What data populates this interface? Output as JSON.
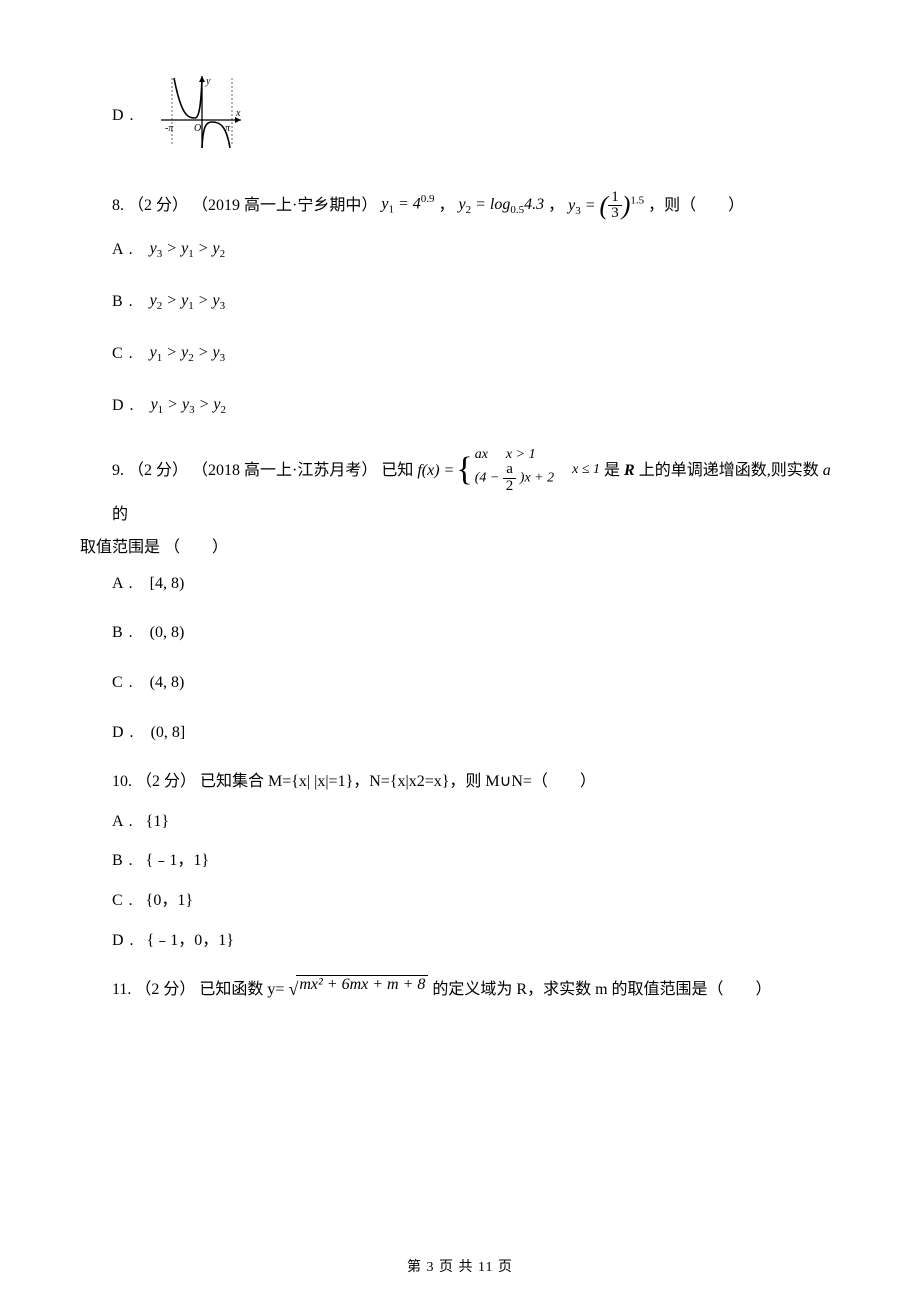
{
  "q7_optD_label": "D .",
  "q8": {
    "stem_prefix": "8.  （2 分） （2019 高一上·宁乡期中）",
    "y1_lhs": "y",
    "y1_sub": "1",
    "y1_eq": "= 4",
    "y1_exp": "0.9",
    "comma1": "，",
    "y2_lhs": "y",
    "y2_sub": "2",
    "y2_eq": "= log",
    "y2_logbase": "0.5",
    "y2_arg": "4.3",
    "comma2": "，",
    "y3_lhs": "y",
    "y3_sub": "3",
    "y3_eq": "=",
    "y3_frac_num": "1",
    "y3_frac_den": "3",
    "y3_exp": "1.5",
    "stem_suffix": "，则（　　）",
    "options": {
      "A": {
        "label": "A .",
        "expr": "y₃ > y₁ > y₂"
      },
      "B": {
        "label": "B .",
        "expr": "y₂ > y₁ > y₃"
      },
      "C": {
        "label": "C .",
        "expr": "y₁ > y₂ > y₃"
      },
      "D": {
        "label": "D .",
        "expr": "y₁ > y₃ > y₂"
      }
    }
  },
  "q9": {
    "stem_prefix": "9.  （2 分） （2018 高一上·江苏月考） 已知",
    "fx": "f",
    "fx_x": "(x) =",
    "row1_left": "ax",
    "row1_right": "x > 1",
    "row2_left_a": "(4 −",
    "row2_left_frac_num": "a",
    "row2_left_frac_den": "2",
    "row2_left_b": ")x + 2",
    "row2_right": "x ≤ 1",
    "stem_mid1": " 是 ",
    "R": "R",
    "stem_mid2": " 上的单调递增函数,则实数 ",
    "a": "a",
    "stem_suffix": " 的取值范围是 （　　）",
    "options": {
      "A": {
        "label": "A .",
        "expr": "[4, 8)"
      },
      "B": {
        "label": "B .",
        "expr": "(0, 8)"
      },
      "C": {
        "label": "C .",
        "expr": "(4, 8)"
      },
      "D": {
        "label": "D .",
        "expr": "(0, 8]"
      }
    }
  },
  "q10": {
    "stem": "10.  （2 分）  已知集合 M={x| |x|=1}，N={x|x2=x}，则 M∪N=（　　）",
    "options": {
      "A": {
        "label": "A .",
        "expr": "{1}"
      },
      "B": {
        "label": "B .",
        "expr": "{﹣1，1}"
      },
      "C": {
        "label": "C .",
        "expr": "{0，1}"
      },
      "D": {
        "label": "D .",
        "expr": "{﹣1，0，1}"
      }
    }
  },
  "q11": {
    "stem_prefix": "11.  （2 分）  已知函数 y=",
    "radicand": "mx² + 6mx + m + 8",
    "stem_suffix": " 的定义域为 R，求实数 m 的取值范围是（　　）"
  },
  "footer": "第 3 页 共 11 页"
}
